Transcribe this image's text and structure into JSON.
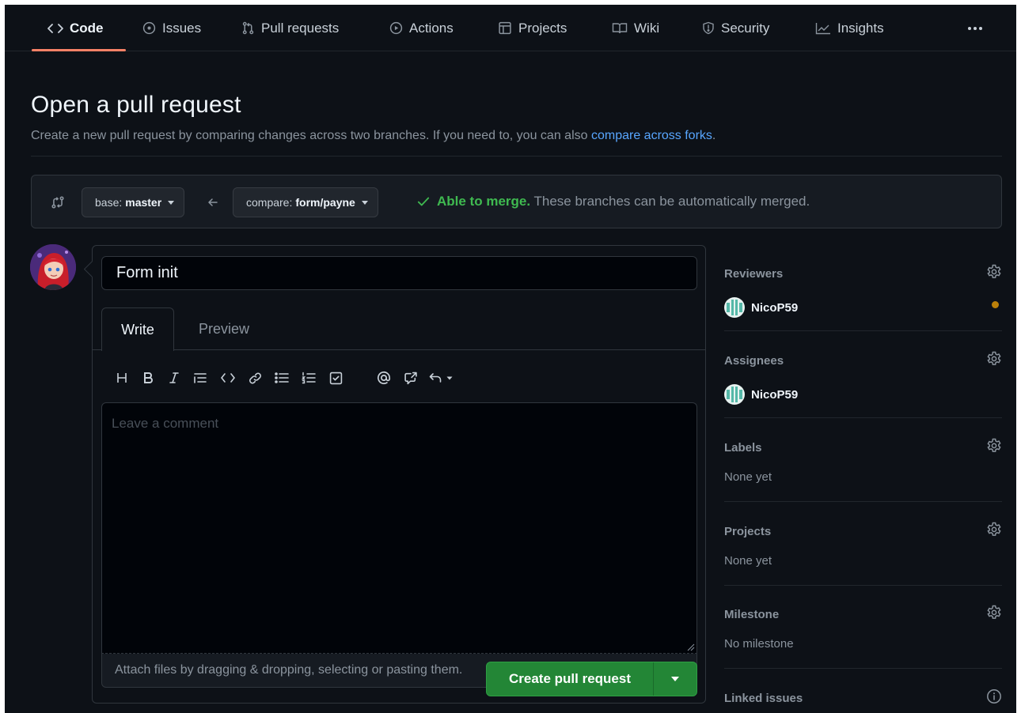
{
  "nav": {
    "tabs": [
      {
        "label": "Code",
        "icon": "code-icon",
        "selected": true
      },
      {
        "label": "Issues",
        "icon": "issue-icon"
      },
      {
        "label": "Pull requests",
        "icon": "git-pull-request-icon"
      },
      {
        "label": "Actions",
        "icon": "play-icon"
      },
      {
        "label": "Projects",
        "icon": "table-icon"
      },
      {
        "label": "Wiki",
        "icon": "book-icon"
      },
      {
        "label": "Security",
        "icon": "shield-icon"
      },
      {
        "label": "Insights",
        "icon": "graph-icon"
      }
    ],
    "more_icon": "kebab-horizontal-icon"
  },
  "header": {
    "title": "Open a pull request",
    "description": "Create a new pull request by comparing changes across two branches. If you need to, you can also ",
    "compare_link": "compare across forks",
    "description_end": "."
  },
  "range": {
    "base_prefix": "base: ",
    "base_branch": "master",
    "compare_prefix": "compare: ",
    "compare_branch": "form/payne",
    "merge_status_strong": "Able to merge.",
    "merge_status_text": " These branches can be automatically merged."
  },
  "composer": {
    "title_value": "Form init",
    "tabs": {
      "write": "Write",
      "preview": "Preview"
    },
    "toolbar_icons": [
      "heading-icon",
      "bold-icon",
      "italic-icon",
      "quote-icon",
      "code-icon",
      "link-icon",
      "unordered-list-icon",
      "ordered-list-icon",
      "tasklist-icon",
      "mention-icon",
      "cross-reference-icon",
      "reply-icon"
    ],
    "comment_placeholder": "Leave a comment",
    "attach_text": "Attach files by dragging & dropping, selecting or pasting them.",
    "markdown_icon": "markdown-icon",
    "create_button": "Create pull request"
  },
  "sidebar": {
    "reviewers": {
      "label": "Reviewers",
      "user": "NicoP59",
      "pending_color": "#bb8009"
    },
    "assignees": {
      "label": "Assignees",
      "user": "NicoP59"
    },
    "labels": {
      "label": "Labels",
      "value": "None yet"
    },
    "projects": {
      "label": "Projects",
      "value": "None yet"
    },
    "milestone": {
      "label": "Milestone",
      "value": "No milestone"
    },
    "linked_issues": {
      "label": "Linked issues"
    }
  },
  "colors": {
    "background": "#0d1117",
    "accent_underline": "#f78166",
    "link": "#58a6ff",
    "success": "#3fb950",
    "primary_button": "#238636"
  }
}
